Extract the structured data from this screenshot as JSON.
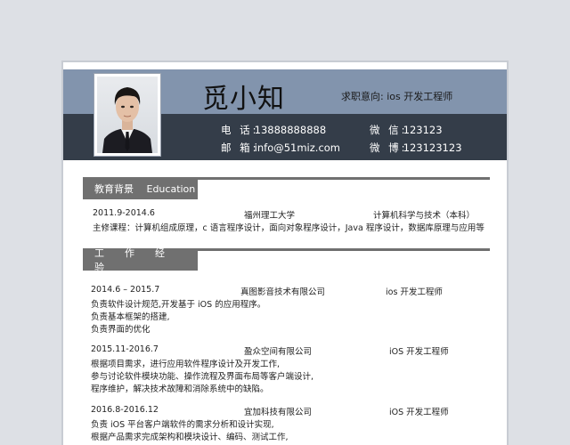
{
  "header": {
    "name": "觅小知",
    "intention_label": "求职意向:",
    "intention_value": "ios 开发工程师",
    "phone_label": "电 话:",
    "phone": "13888888888",
    "email_label": "邮 箱:",
    "email": "info@51miz.com",
    "wechat_label": "微 信:",
    "wechat": "123123",
    "weibo_label": "微 博:",
    "weibo": "123123123"
  },
  "education": {
    "title": "教育背景　 Education",
    "period": "2011.9-2014.6",
    "school": "福州理工大学",
    "major": "计算机科学与技术（本科）",
    "courses": "主修课程：计算机组成原理，c 语言程序设计，面向对象程序设计，Java 程序设计，数据库原理与应用等"
  },
  "work": {
    "title": "工作经验",
    "jobs": [
      {
        "period": "2014.6 – 2015.7",
        "company": "真图影音技术有限公司",
        "position": "ios 开发工程师",
        "duties": [
          "负责软件设计规范,开发基于 iOS 的应用程序。",
          "负责基本框架的搭建,",
          "负责界面的优化"
        ]
      },
      {
        "period": "2015.11-2016.7",
        "company": "盈众空间有限公司",
        "position": "iOS 开发工程师",
        "duties": [
          "根据项目需求，进行应用软件程序设计及开发工作,",
          "参与讨论软件模块功能、操作流程及界面布局等客户端设计,",
          "程序维护，解决技术故障和消除系统中的缺陷。"
        ]
      },
      {
        "period": "2016.8-2016.12",
        "company": "宜加科技有限公司",
        "position": "iOS 开发工程师",
        "duties": [
          "负责 iOS 平台客户端软件的需求分析和设计实现,",
          "根据产品需求完成架构和模块设计、编码、测试工作,"
        ]
      }
    ]
  }
}
